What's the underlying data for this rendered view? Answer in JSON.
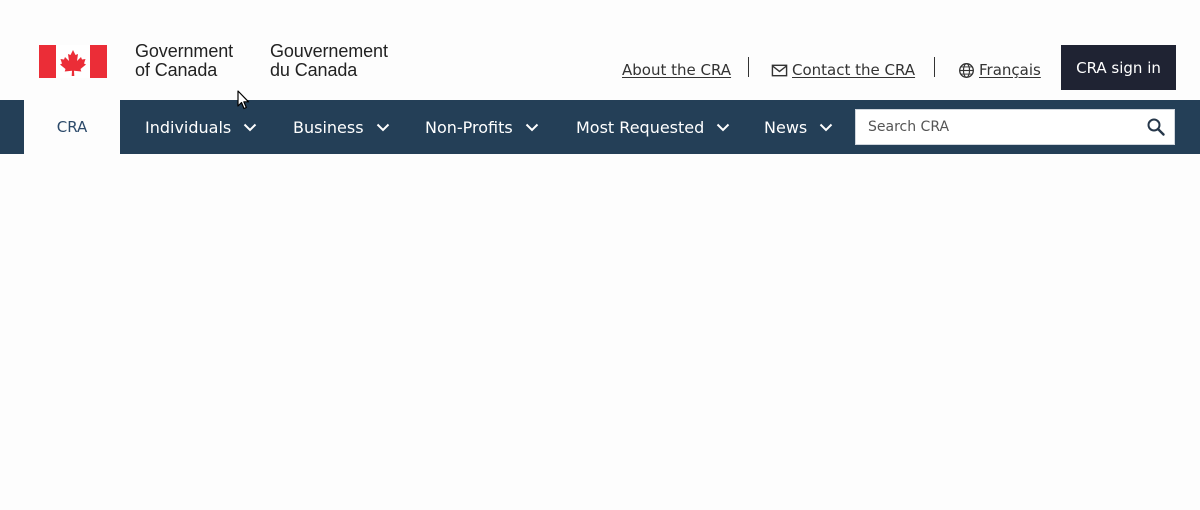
{
  "header": {
    "flag_icon": "canada-flag-icon",
    "gov_en": [
      "Government",
      "of Canada"
    ],
    "gov_fr": [
      "Gouvernement",
      "du Canada"
    ],
    "links": {
      "about": "About the CRA",
      "contact": "Contact the CRA",
      "contact_icon": "envelope-icon",
      "language": "Français",
      "language_icon": "globe-icon"
    },
    "signin_label": "CRA sign in"
  },
  "nav": {
    "home": "CRA",
    "items": [
      {
        "label": "Individuals",
        "icon": "chevron-down-icon"
      },
      {
        "label": "Business",
        "icon": "chevron-down-icon"
      },
      {
        "label": "Non-Profits",
        "icon": "chevron-down-icon"
      },
      {
        "label": "Most Requested",
        "icon": "chevron-down-icon"
      },
      {
        "label": "News",
        "icon": "chevron-down-icon"
      }
    ],
    "search": {
      "placeholder": "Search CRA",
      "value": "",
      "icon": "search-icon"
    }
  },
  "colors": {
    "nav_bg": "#243f57",
    "signin_bg": "#1f2333",
    "flag_red": "#eb2d37",
    "page_bg": "#fdfdfd"
  }
}
